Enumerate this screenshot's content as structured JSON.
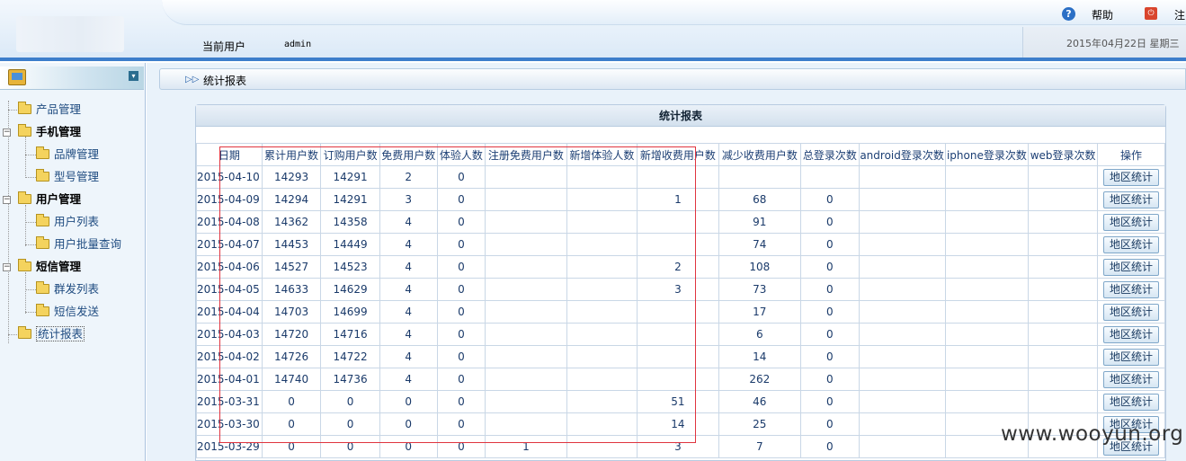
{
  "header": {
    "help_label": "帮助",
    "logout_label": "注",
    "current_user_label": "当前用户",
    "current_user_value": "admin",
    "date_text": "2015年04月22日   星期三"
  },
  "sidebar": {
    "items": [
      {
        "label": "产品管理"
      },
      {
        "label": "手机管理"
      },
      {
        "label": "品牌管理"
      },
      {
        "label": "型号管理"
      },
      {
        "label": "用户管理"
      },
      {
        "label": "用户列表"
      },
      {
        "label": "用户批量查询"
      },
      {
        "label": "短信管理"
      },
      {
        "label": "群发列表"
      },
      {
        "label": "短信发送"
      },
      {
        "label": "统计报表"
      }
    ]
  },
  "main": {
    "breadcrumb": "统计报表",
    "panel_title": "统计报表",
    "columns": [
      "日期",
      "累计用户数",
      "订购用户数",
      "免费用户数",
      "体验人数",
      "注册免费用户数",
      "新增体验人数",
      "新增收费用户数",
      "减少收费用户数",
      "总登录次数",
      "android登录次数",
      "iphone登录次数",
      "web登录次数",
      "操作"
    ],
    "action_label": "地区统计",
    "rows": [
      [
        "2015-04-10",
        "14293",
        "14291",
        "2",
        "0",
        "",
        "",
        "",
        "",
        "",
        "",
        "",
        "",
        "地区统计"
      ],
      [
        "2015-04-09",
        "14294",
        "14291",
        "3",
        "0",
        "",
        "",
        "1",
        "68",
        "0",
        "",
        "",
        "",
        "地区统计"
      ],
      [
        "2015-04-08",
        "14362",
        "14358",
        "4",
        "0",
        "",
        "",
        "",
        "91",
        "0",
        "",
        "",
        "",
        "地区统计"
      ],
      [
        "2015-04-07",
        "14453",
        "14449",
        "4",
        "0",
        "",
        "",
        "",
        "74",
        "0",
        "",
        "",
        "",
        "地区统计"
      ],
      [
        "2015-04-06",
        "14527",
        "14523",
        "4",
        "0",
        "",
        "",
        "2",
        "108",
        "0",
        "",
        "",
        "",
        "地区统计"
      ],
      [
        "2015-04-05",
        "14633",
        "14629",
        "4",
        "0",
        "",
        "",
        "3",
        "73",
        "0",
        "",
        "",
        "",
        "地区统计"
      ],
      [
        "2015-04-04",
        "14703",
        "14699",
        "4",
        "0",
        "",
        "",
        "",
        "17",
        "0",
        "",
        "",
        "",
        "地区统计"
      ],
      [
        "2015-04-03",
        "14720",
        "14716",
        "4",
        "0",
        "",
        "",
        "",
        "6",
        "0",
        "",
        "",
        "",
        "地区统计"
      ],
      [
        "2015-04-02",
        "14726",
        "14722",
        "4",
        "0",
        "",
        "",
        "",
        "14",
        "0",
        "",
        "",
        "",
        "地区统计"
      ],
      [
        "2015-04-01",
        "14740",
        "14736",
        "4",
        "0",
        "",
        "",
        "",
        "262",
        "0",
        "",
        "",
        "",
        "地区统计"
      ],
      [
        "2015-03-31",
        "0",
        "0",
        "0",
        "0",
        "",
        "",
        "51",
        "46",
        "0",
        "",
        "",
        "",
        "地区统计"
      ],
      [
        "2015-03-30",
        "0",
        "0",
        "0",
        "0",
        "",
        "",
        "14",
        "25",
        "0",
        "",
        "",
        "",
        "地区统计"
      ],
      [
        "2015-03-29",
        "0",
        "0",
        "0",
        "0",
        "1",
        "",
        "3",
        "7",
        "0",
        "",
        "",
        "",
        "地区统计"
      ]
    ]
  },
  "watermark": "www.wooyun.org"
}
